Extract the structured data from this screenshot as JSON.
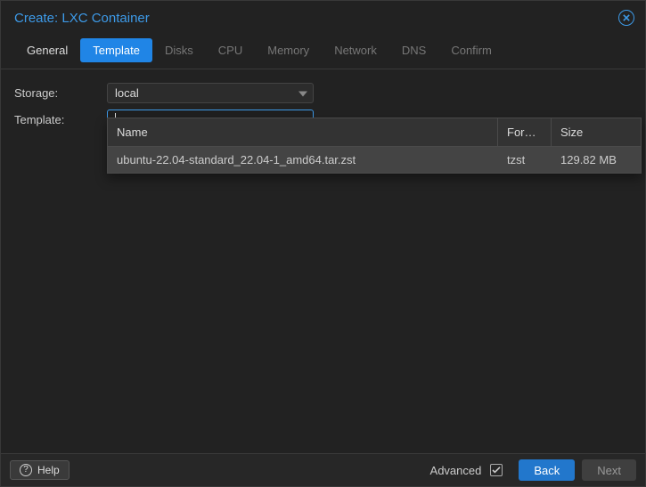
{
  "window": {
    "title": "Create: LXC Container"
  },
  "tabs": [
    {
      "label": "General",
      "state": "enabled"
    },
    {
      "label": "Template",
      "state": "active"
    },
    {
      "label": "Disks",
      "state": "disabled"
    },
    {
      "label": "CPU",
      "state": "disabled"
    },
    {
      "label": "Memory",
      "state": "disabled"
    },
    {
      "label": "Network",
      "state": "disabled"
    },
    {
      "label": "DNS",
      "state": "disabled"
    },
    {
      "label": "Confirm",
      "state": "disabled"
    }
  ],
  "form": {
    "storage_label": "Storage:",
    "storage_value": "local",
    "template_label": "Template:",
    "template_value": ""
  },
  "dropdown": {
    "headers": {
      "name": "Name",
      "format": "For…",
      "size": "Size"
    },
    "rows": [
      {
        "name": "ubuntu-22.04-standard_22.04-1_amd64.tar.zst",
        "format": "tzst",
        "size": "129.82 MB"
      }
    ]
  },
  "footer": {
    "help": "Help",
    "advanced_label": "Advanced",
    "advanced_checked": true,
    "back": "Back",
    "next": "Next"
  }
}
